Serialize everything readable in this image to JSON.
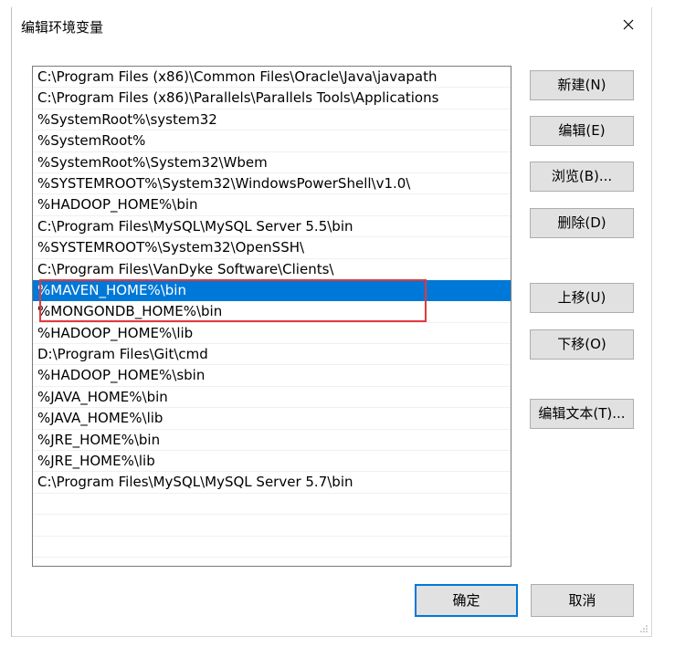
{
  "dialog": {
    "title": "编辑环境变量"
  },
  "list": {
    "selected_index": 10,
    "items": [
      "C:\\Program Files (x86)\\Common Files\\Oracle\\Java\\javapath",
      "C:\\Program Files (x86)\\Parallels\\Parallels Tools\\Applications",
      "%SystemRoot%\\system32",
      "%SystemRoot%",
      "%SystemRoot%\\System32\\Wbem",
      "%SYSTEMROOT%\\System32\\WindowsPowerShell\\v1.0\\",
      "%HADOOP_HOME%\\bin",
      "C:\\Program Files\\MySQL\\MySQL Server 5.5\\bin",
      "%SYSTEMROOT%\\System32\\OpenSSH\\",
      "C:\\Program Files\\VanDyke Software\\Clients\\",
      "%MAVEN_HOME%\\bin",
      "%MONGONDB_HOME%\\bin",
      "%HADOOP_HOME%\\lib",
      "D:\\Program Files\\Git\\cmd",
      "%HADOOP_HOME%\\sbin",
      "%JAVA_HOME%\\bin",
      "%JAVA_HOME%\\lib",
      "%JRE_HOME%\\bin",
      "%JRE_HOME%\\lib",
      "C:\\Program Files\\MySQL\\MySQL Server 5.7\\bin",
      "",
      "",
      ""
    ]
  },
  "buttons": {
    "new": "新建(N)",
    "edit": "编辑(E)",
    "browse": "浏览(B)...",
    "delete": "删除(D)",
    "move_up": "上移(U)",
    "move_down": "下移(O)",
    "edit_text": "编辑文本(T)...",
    "ok": "确定",
    "cancel": "取消"
  },
  "colors": {
    "selection": "#0078d7",
    "highlight_annotation": "#e0393e"
  }
}
